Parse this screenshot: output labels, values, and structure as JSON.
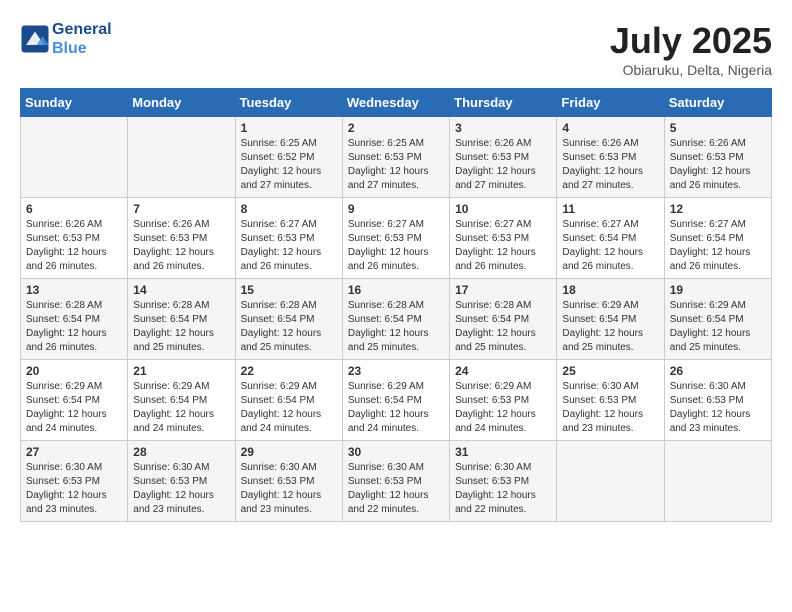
{
  "header": {
    "logo_line1": "General",
    "logo_line2": "Blue",
    "month_title": "July 2025",
    "location": "Obiaruku, Delta, Nigeria"
  },
  "weekdays": [
    "Sunday",
    "Monday",
    "Tuesday",
    "Wednesday",
    "Thursday",
    "Friday",
    "Saturday"
  ],
  "weeks": [
    [
      {
        "day": "",
        "sunrise": "",
        "sunset": "",
        "daylight": ""
      },
      {
        "day": "",
        "sunrise": "",
        "sunset": "",
        "daylight": ""
      },
      {
        "day": "1",
        "sunrise": "Sunrise: 6:25 AM",
        "sunset": "Sunset: 6:52 PM",
        "daylight": "Daylight: 12 hours and 27 minutes."
      },
      {
        "day": "2",
        "sunrise": "Sunrise: 6:25 AM",
        "sunset": "Sunset: 6:53 PM",
        "daylight": "Daylight: 12 hours and 27 minutes."
      },
      {
        "day": "3",
        "sunrise": "Sunrise: 6:26 AM",
        "sunset": "Sunset: 6:53 PM",
        "daylight": "Daylight: 12 hours and 27 minutes."
      },
      {
        "day": "4",
        "sunrise": "Sunrise: 6:26 AM",
        "sunset": "Sunset: 6:53 PM",
        "daylight": "Daylight: 12 hours and 27 minutes."
      },
      {
        "day": "5",
        "sunrise": "Sunrise: 6:26 AM",
        "sunset": "Sunset: 6:53 PM",
        "daylight": "Daylight: 12 hours and 26 minutes."
      }
    ],
    [
      {
        "day": "6",
        "sunrise": "Sunrise: 6:26 AM",
        "sunset": "Sunset: 6:53 PM",
        "daylight": "Daylight: 12 hours and 26 minutes."
      },
      {
        "day": "7",
        "sunrise": "Sunrise: 6:26 AM",
        "sunset": "Sunset: 6:53 PM",
        "daylight": "Daylight: 12 hours and 26 minutes."
      },
      {
        "day": "8",
        "sunrise": "Sunrise: 6:27 AM",
        "sunset": "Sunset: 6:53 PM",
        "daylight": "Daylight: 12 hours and 26 minutes."
      },
      {
        "day": "9",
        "sunrise": "Sunrise: 6:27 AM",
        "sunset": "Sunset: 6:53 PM",
        "daylight": "Daylight: 12 hours and 26 minutes."
      },
      {
        "day": "10",
        "sunrise": "Sunrise: 6:27 AM",
        "sunset": "Sunset: 6:53 PM",
        "daylight": "Daylight: 12 hours and 26 minutes."
      },
      {
        "day": "11",
        "sunrise": "Sunrise: 6:27 AM",
        "sunset": "Sunset: 6:54 PM",
        "daylight": "Daylight: 12 hours and 26 minutes."
      },
      {
        "day": "12",
        "sunrise": "Sunrise: 6:27 AM",
        "sunset": "Sunset: 6:54 PM",
        "daylight": "Daylight: 12 hours and 26 minutes."
      }
    ],
    [
      {
        "day": "13",
        "sunrise": "Sunrise: 6:28 AM",
        "sunset": "Sunset: 6:54 PM",
        "daylight": "Daylight: 12 hours and 26 minutes."
      },
      {
        "day": "14",
        "sunrise": "Sunrise: 6:28 AM",
        "sunset": "Sunset: 6:54 PM",
        "daylight": "Daylight: 12 hours and 25 minutes."
      },
      {
        "day": "15",
        "sunrise": "Sunrise: 6:28 AM",
        "sunset": "Sunset: 6:54 PM",
        "daylight": "Daylight: 12 hours and 25 minutes."
      },
      {
        "day": "16",
        "sunrise": "Sunrise: 6:28 AM",
        "sunset": "Sunset: 6:54 PM",
        "daylight": "Daylight: 12 hours and 25 minutes."
      },
      {
        "day": "17",
        "sunrise": "Sunrise: 6:28 AM",
        "sunset": "Sunset: 6:54 PM",
        "daylight": "Daylight: 12 hours and 25 minutes."
      },
      {
        "day": "18",
        "sunrise": "Sunrise: 6:29 AM",
        "sunset": "Sunset: 6:54 PM",
        "daylight": "Daylight: 12 hours and 25 minutes."
      },
      {
        "day": "19",
        "sunrise": "Sunrise: 6:29 AM",
        "sunset": "Sunset: 6:54 PM",
        "daylight": "Daylight: 12 hours and 25 minutes."
      }
    ],
    [
      {
        "day": "20",
        "sunrise": "Sunrise: 6:29 AM",
        "sunset": "Sunset: 6:54 PM",
        "daylight": "Daylight: 12 hours and 24 minutes."
      },
      {
        "day": "21",
        "sunrise": "Sunrise: 6:29 AM",
        "sunset": "Sunset: 6:54 PM",
        "daylight": "Daylight: 12 hours and 24 minutes."
      },
      {
        "day": "22",
        "sunrise": "Sunrise: 6:29 AM",
        "sunset": "Sunset: 6:54 PM",
        "daylight": "Daylight: 12 hours and 24 minutes."
      },
      {
        "day": "23",
        "sunrise": "Sunrise: 6:29 AM",
        "sunset": "Sunset: 6:54 PM",
        "daylight": "Daylight: 12 hours and 24 minutes."
      },
      {
        "day": "24",
        "sunrise": "Sunrise: 6:29 AM",
        "sunset": "Sunset: 6:53 PM",
        "daylight": "Daylight: 12 hours and 24 minutes."
      },
      {
        "day": "25",
        "sunrise": "Sunrise: 6:30 AM",
        "sunset": "Sunset: 6:53 PM",
        "daylight": "Daylight: 12 hours and 23 minutes."
      },
      {
        "day": "26",
        "sunrise": "Sunrise: 6:30 AM",
        "sunset": "Sunset: 6:53 PM",
        "daylight": "Daylight: 12 hours and 23 minutes."
      }
    ],
    [
      {
        "day": "27",
        "sunrise": "Sunrise: 6:30 AM",
        "sunset": "Sunset: 6:53 PM",
        "daylight": "Daylight: 12 hours and 23 minutes."
      },
      {
        "day": "28",
        "sunrise": "Sunrise: 6:30 AM",
        "sunset": "Sunset: 6:53 PM",
        "daylight": "Daylight: 12 hours and 23 minutes."
      },
      {
        "day": "29",
        "sunrise": "Sunrise: 6:30 AM",
        "sunset": "Sunset: 6:53 PM",
        "daylight": "Daylight: 12 hours and 23 minutes."
      },
      {
        "day": "30",
        "sunrise": "Sunrise: 6:30 AM",
        "sunset": "Sunset: 6:53 PM",
        "daylight": "Daylight: 12 hours and 22 minutes."
      },
      {
        "day": "31",
        "sunrise": "Sunrise: 6:30 AM",
        "sunset": "Sunset: 6:53 PM",
        "daylight": "Daylight: 12 hours and 22 minutes."
      },
      {
        "day": "",
        "sunrise": "",
        "sunset": "",
        "daylight": ""
      },
      {
        "day": "",
        "sunrise": "",
        "sunset": "",
        "daylight": ""
      }
    ]
  ]
}
